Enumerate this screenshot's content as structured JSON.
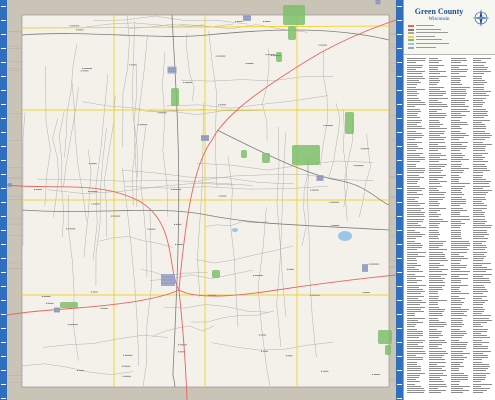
{
  "map": {
    "title": "Green County",
    "subtitle": "Wisconsin",
    "colors": {
      "land": "#f3f1ea",
      "road_minor": "#a9a9a9",
      "road_major": "#7d7d7d",
      "highway": "#e8645f",
      "township_line": "#f0d22a",
      "park": "#7bbf6a",
      "water": "#9cc5e8",
      "city": "#9aa3c8",
      "border_band": "#c9c4b6",
      "rail": "#2f6fc0"
    }
  },
  "legend": {
    "swatches": [
      "#e8645f",
      "#7d7d7d",
      "#a9a9a9",
      "#f0d22a",
      "#7bbf6a",
      "#9cc5e8",
      "#9aa3c8"
    ]
  }
}
